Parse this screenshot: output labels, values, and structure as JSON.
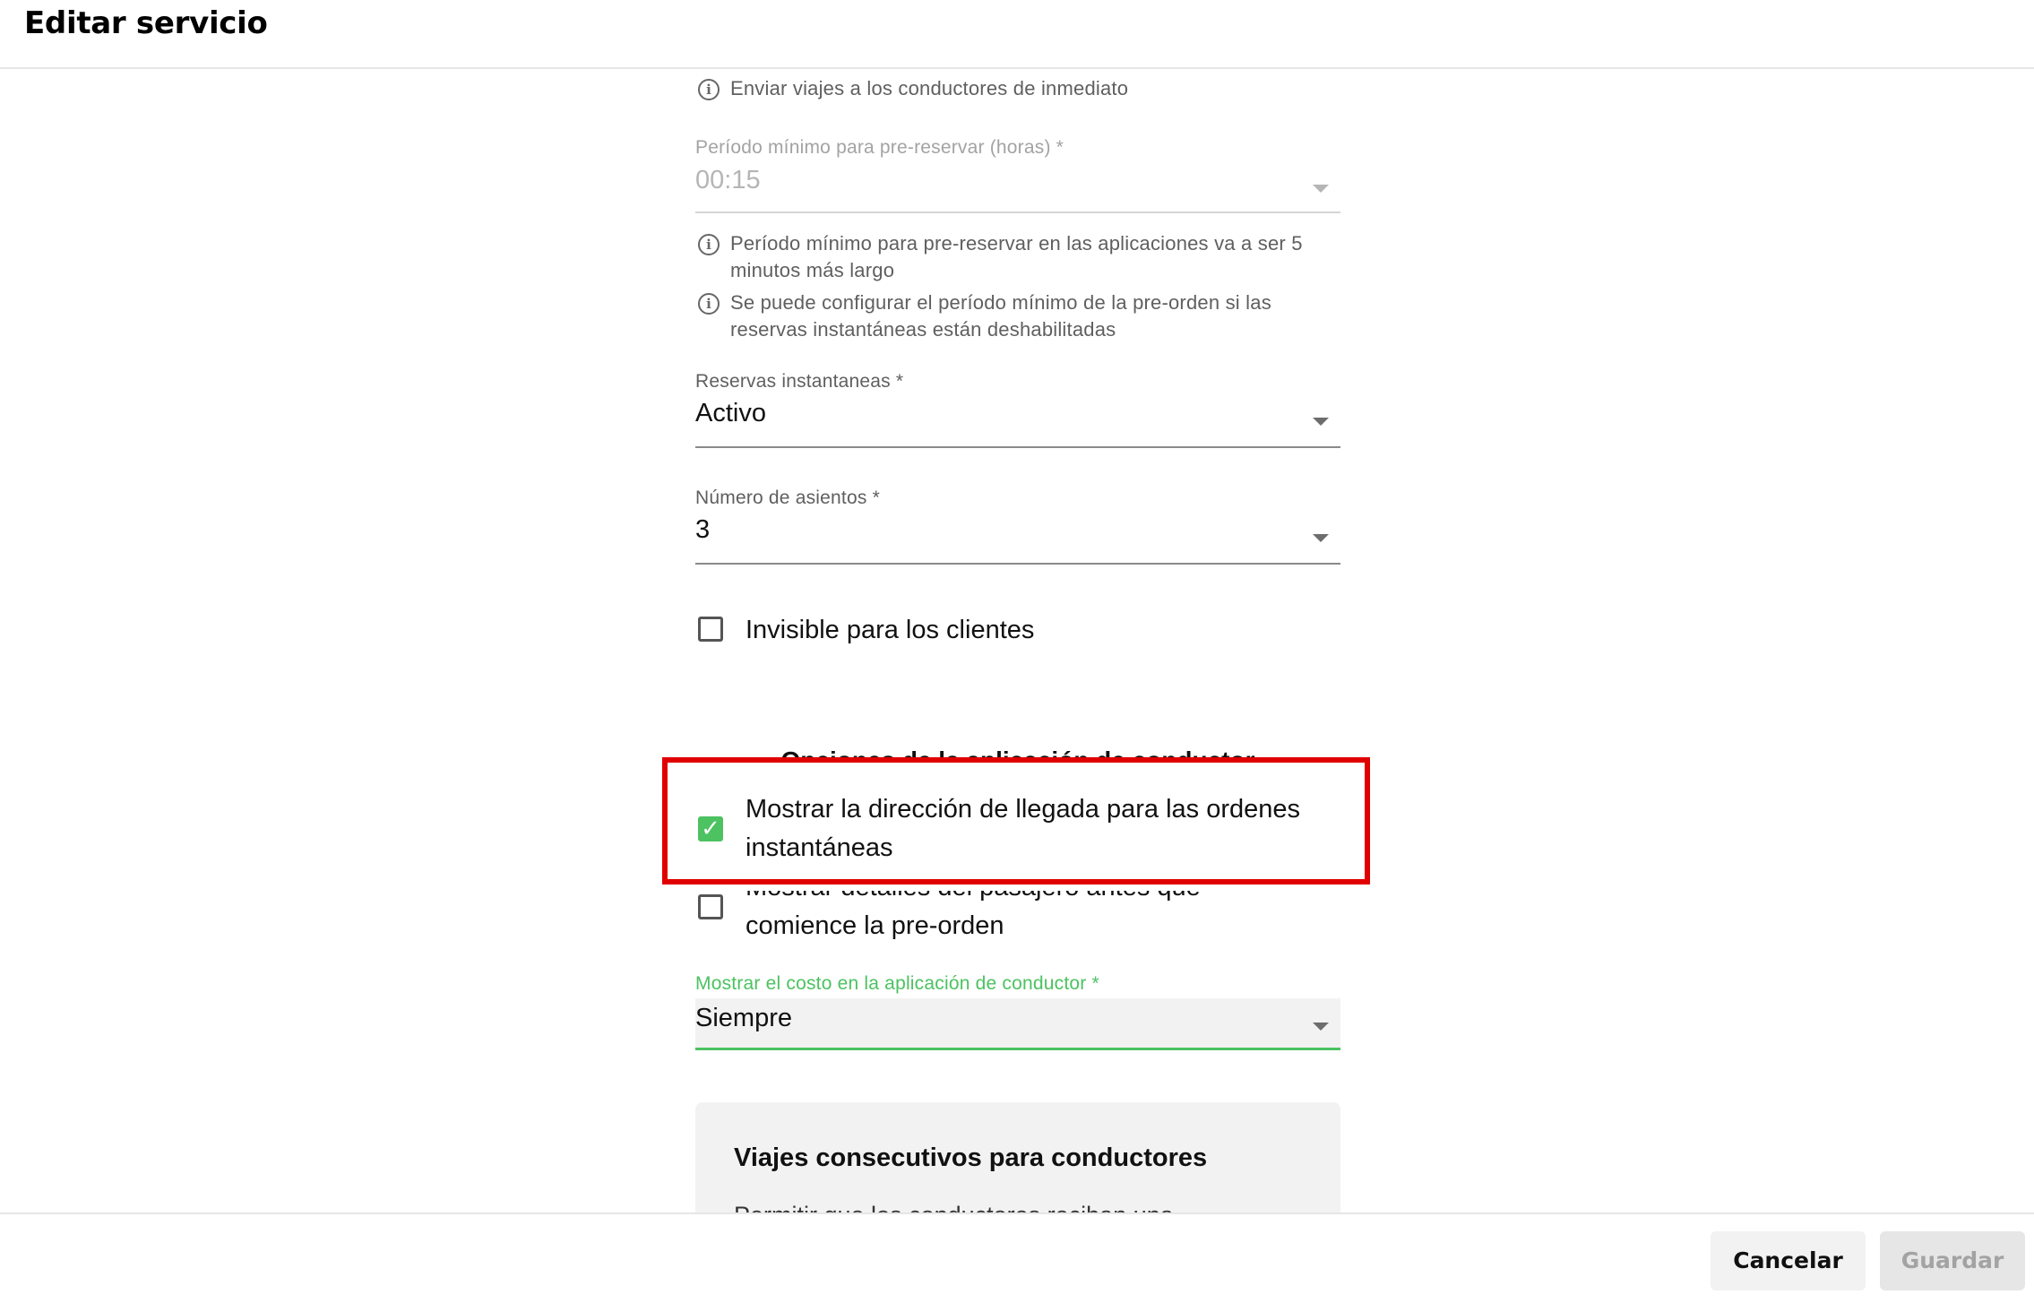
{
  "header": {
    "title": "Editar servicio"
  },
  "hints": {
    "send_immediately": "Enviar viajes a los conductores de inmediato",
    "min_period_line1": "Período mínimo para pre-reservar en las aplicaciones va a ser 5",
    "min_period_line2": "minutos más largo",
    "configurable_line1": "Se puede configurar el período mínimo de la pre-orden si las",
    "configurable_line2": "reservas instantáneas están deshabilitadas"
  },
  "fields": {
    "min_period": {
      "label": "Período mínimo para pre-reservar (horas) *",
      "value": "00:15"
    },
    "instant": {
      "label": "Reservas instantaneas *",
      "value": "Activo"
    },
    "seats": {
      "label": "Número de asientos *",
      "value": "3"
    },
    "cost": {
      "label": "Mostrar el costo en la aplicación de conductor *",
      "value": "Siempre"
    }
  },
  "checkboxes": {
    "invisible": {
      "label": "Invisible para los clientes",
      "checked": false
    },
    "arrival_address": {
      "label_line1": "Mostrar la dirección de llegada para las ordenes",
      "label_line2": "instantáneas",
      "checked": true
    },
    "passenger_details": {
      "label_line1": "Mostrar detalles del pasajero antes que",
      "label_line2": "comience la pre-orden",
      "checked": false
    }
  },
  "driver_app_section": {
    "title": "Opciones de la aplicación de conductor"
  },
  "consecutive_card": {
    "title": "Viajes consecutivos para conductores",
    "text": "Permitir que los conductores reciban una"
  },
  "footer": {
    "cancel_label": "Cancelar",
    "save_label": "Guardar"
  },
  "colors": {
    "accent": "#4cc261",
    "highlight": "#e00000"
  },
  "icons": {
    "info": "info-icon",
    "caret": "caret-down-icon",
    "check": "check-icon"
  }
}
